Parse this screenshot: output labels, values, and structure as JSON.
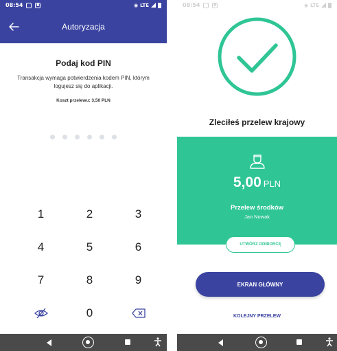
{
  "colors": {
    "primary": "#3a43a0",
    "success": "#2fc595",
    "dot": "#dde1e6",
    "navbar": "#4a4a4a"
  },
  "status_bar": {
    "time": "08:54",
    "network": "LTE"
  },
  "pin_screen": {
    "title": "Autoryzacja",
    "heading": "Podaj kod PIN",
    "description": "Transakcja wymaga potwierdzenia kodem PIN, którym logujesz się do aplikacji.",
    "fee": "Koszt przelewu: 3,50 PLN",
    "pin_length": 6,
    "keys": [
      "1",
      "2",
      "3",
      "4",
      "5",
      "6",
      "7",
      "8",
      "9",
      "",
      "0",
      ""
    ],
    "icons": {
      "back": "arrow-left-icon",
      "toggle": "eye-off-icon",
      "delete": "backspace-icon"
    }
  },
  "success_screen": {
    "heading": "Zleciłeś przelew krajowy",
    "amount": "5,00",
    "currency": "PLN",
    "transfer_title": "Przelew środków",
    "recipient": "Jan Nowak",
    "create_recipient_label": "UTWÓRZ ODBIORCĘ",
    "main_screen_label": "EKRAN GŁÓWNY",
    "next_transfer_label": "KOLEJNY PRZELEW",
    "icons": {
      "status": "check-circle-icon",
      "recipient": "person-icon"
    }
  },
  "nav_icons": [
    "back-icon",
    "home-icon",
    "recent-apps-icon",
    "accessibility-icon"
  ]
}
